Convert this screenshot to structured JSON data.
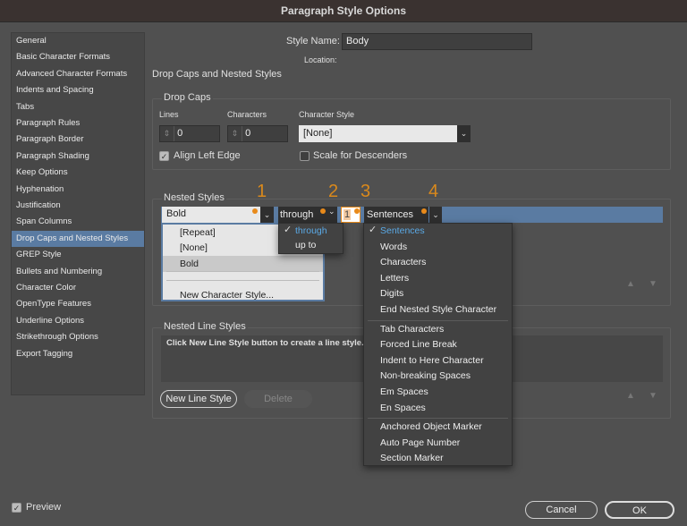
{
  "window": {
    "title": "Paragraph Style Options"
  },
  "sidebar": {
    "items": [
      "General",
      "Basic Character Formats",
      "Advanced Character Formats",
      "Indents and Spacing",
      "Tabs",
      "Paragraph Rules",
      "Paragraph Border",
      "Paragraph Shading",
      "Keep Options",
      "Hyphenation",
      "Justification",
      "Span Columns",
      "Drop Caps and Nested Styles",
      "GREP Style",
      "Bullets and Numbering",
      "Character Color",
      "OpenType Features",
      "Underline Options",
      "Strikethrough Options",
      "Export Tagging"
    ],
    "selected": "Drop Caps and Nested Styles"
  },
  "header": {
    "style_name_label": "Style Name:",
    "style_name": "Body",
    "location_label": "Location:",
    "section_title": "Drop Caps and Nested Styles"
  },
  "drop_caps": {
    "title": "Drop Caps",
    "lines_label": "Lines",
    "lines": "0",
    "characters_label": "Characters",
    "characters": "0",
    "char_style_label": "Character Style",
    "char_style": "[None]",
    "align_left_edge": "Align Left Edge",
    "align_left_checked": true,
    "scale_desc": "Scale for Descenders",
    "scale_desc_checked": false
  },
  "nested": {
    "title": "Nested Styles",
    "style": "Bold",
    "relation": "through",
    "count": "1",
    "unit": "Sentences",
    "annotations": [
      "1",
      "2",
      "3",
      "4"
    ],
    "style_menu": [
      "[Repeat]",
      "[None]",
      "Bold",
      "",
      "New Character Style..."
    ],
    "relation_menu": [
      "through",
      "up to"
    ],
    "unit_menu": [
      "Sentences",
      "Words",
      "Characters",
      "Letters",
      "Digits",
      "End Nested Style Character",
      "Tab Characters",
      "Forced Line Break",
      "Indent to Here Character",
      "Non-breaking Spaces",
      "Em Spaces",
      "En Spaces",
      "Anchored Object Marker",
      "Auto Page Number",
      "Section Marker"
    ]
  },
  "nested_line": {
    "title": "Nested Line Styles",
    "hint": "Click New Line Style button to create a line style.",
    "new_button": "New Line Style",
    "delete_button": "Delete"
  },
  "footer": {
    "preview": "Preview",
    "cancel": "Cancel",
    "ok": "OK"
  },
  "colors": {
    "accent": "#5a7ba2",
    "annotation": "#d9891c",
    "check_blue": "#5aa9e6"
  }
}
